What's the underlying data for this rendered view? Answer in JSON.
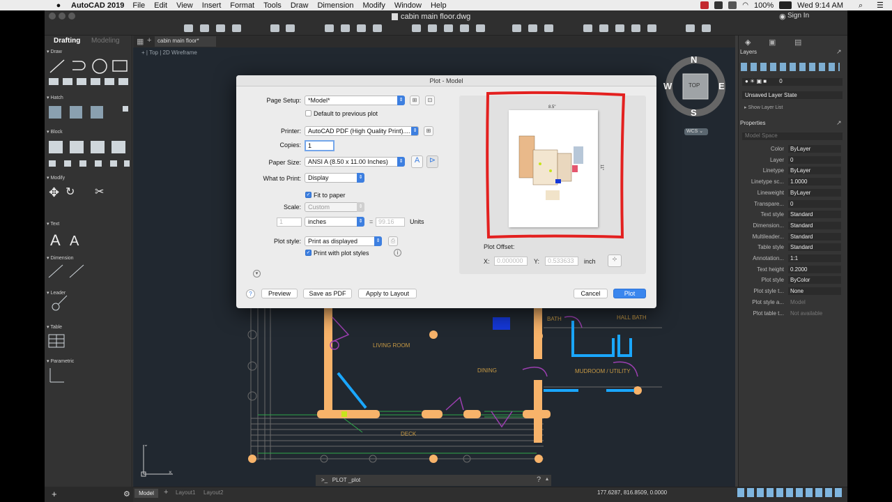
{
  "menubar": {
    "app": "AutoCAD 2019",
    "items": [
      "File",
      "Edit",
      "View",
      "Insert",
      "Format",
      "Tools",
      "Draw",
      "Dimension",
      "Modify",
      "Window",
      "Help"
    ],
    "battery": "100%",
    "clock": "Wed 9:14 AM"
  },
  "window": {
    "title": "cabin main floor.dwg",
    "signin": "Sign In"
  },
  "palette": {
    "tabs": [
      "Drafting",
      "Modeling"
    ],
    "sections": [
      "Draw",
      "Hatch",
      "Block",
      "Modify",
      "Text",
      "Dimension",
      "Leader",
      "Table",
      "Parametric"
    ]
  },
  "doc": {
    "tab": "cabin main floor*",
    "view_label": "[-] Top [2D Wireframe]",
    "view_parts": [
      "+",
      "Top",
      "2D Wireframe"
    ]
  },
  "compass": {
    "n": "N",
    "s": "S",
    "e": "E",
    "w": "W",
    "top": "TOP",
    "wcs": "WCS"
  },
  "drawing_labels": {
    "living": "LIVING ROOM",
    "dining": "DINING",
    "deck": "DECK",
    "mudroom": "MUDROOM / UTILITY",
    "hall": "HALL BATH",
    "bath": "BATH"
  },
  "right": {
    "layers_title": "Layers",
    "layer_num": "0",
    "layer_state": "Unsaved Layer State",
    "show_layer_list": "Show Layer List",
    "properties_title": "Properties",
    "model_space": "Model Space",
    "props": [
      {
        "label": "Color",
        "value": "ByLayer"
      },
      {
        "label": "Layer",
        "value": "0"
      },
      {
        "label": "Linetype",
        "value": "ByLayer"
      },
      {
        "label": "Linetype sc...",
        "value": "1.0000"
      },
      {
        "label": "Lineweight",
        "value": "ByLayer"
      },
      {
        "label": "Transpare...",
        "value": "0"
      },
      {
        "label": "Text style",
        "value": "Standard"
      },
      {
        "label": "Dimension...",
        "value": "Standard"
      },
      {
        "label": "Multileader...",
        "value": "Standard"
      },
      {
        "label": "Table style",
        "value": "Standard"
      },
      {
        "label": "Annotation...",
        "value": "1:1"
      },
      {
        "label": "Text height",
        "value": "0.2000"
      },
      {
        "label": "Plot style",
        "value": "ByColor"
      },
      {
        "label": "Plot style t...",
        "value": "None"
      },
      {
        "label": "Plot style a...",
        "value": "Model"
      },
      {
        "label": "Plot table t...",
        "value": "Not available"
      }
    ]
  },
  "status": {
    "tabs": [
      "Model",
      "Layout1",
      "Layout2"
    ],
    "coords": "177.6287, 816.8509, 0.0000",
    "command": "PLOT _plot",
    "prompt": ">_"
  },
  "dialog": {
    "title": "Plot - Model",
    "page_setup_label": "Page Setup:",
    "page_setup_value": "*Model*",
    "default_prev": "Default to previous plot",
    "printer_label": "Printer:",
    "printer_value": "AutoCAD PDF (High Quality Print)....",
    "copies_label": "Copies:",
    "copies_value": "1",
    "paper_label": "Paper Size:",
    "paper_value": "ANSI A (8.50 x 11.00 Inches)",
    "what_label": "What to Print:",
    "what_value": "Display",
    "fit_label": "Fit to paper",
    "scale_label": "Scale:",
    "scale_value": "Custom",
    "scale_num": "1",
    "units_value": "inches",
    "equals": "=",
    "scale_units": "99.16",
    "units_label": "Units",
    "plotstyle_label": "Plot style:",
    "plotstyle_value": "Print as displayed",
    "print_styles": "Print with plot styles",
    "preview_width": "8.5\"",
    "preview_height": "11\"",
    "offset_label": "Plot Offset:",
    "x_label": "X:",
    "x_value": "0.000000",
    "y_label": "Y:",
    "y_value": "0.533633",
    "inch": "inch",
    "help": "?",
    "preview_btn": "Preview",
    "pdf_btn": "Save as PDF",
    "apply_btn": "Apply to Layout",
    "cancel_btn": "Cancel",
    "plot_btn": "Plot"
  },
  "colors": {
    "accent": "#3d7fe0",
    "annotation": "#e3201f",
    "wall": "#f7b36a",
    "plumbing": "#1aa7ff",
    "door": "#9c3fb0"
  }
}
